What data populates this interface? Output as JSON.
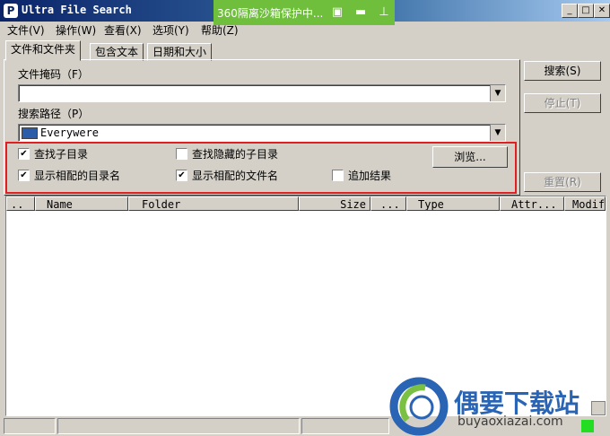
{
  "window": {
    "title": "Ultra File Search",
    "minimize_glyph": "_",
    "maximize_glyph": "□",
    "close_glyph": "✕"
  },
  "sandbox_overlay": {
    "text": "360隔离沙箱保护中...",
    "icons": [
      "shield-icon",
      "folder-icon",
      "pin-icon"
    ],
    "color": "#6fbf3c"
  },
  "menu": [
    "文件(V)",
    "操作(W)",
    "查看(X)",
    "选项(Y)",
    "帮助(Z)"
  ],
  "tabs": [
    "文件和文件夹",
    "包含文本",
    "日期和大小"
  ],
  "form": {
    "file_mask_label": "文件掩码（F）",
    "file_mask_value": "",
    "search_path_label": "搜索路径（P）",
    "search_path_value": "Everywere",
    "checkboxes": [
      {
        "label": "查找子目录",
        "checked": true
      },
      {
        "label": "查找隐藏的子目录",
        "checked": false
      },
      {
        "label": "显示相配的目录名",
        "checked": true
      },
      {
        "label": "显示相配的文件名",
        "checked": true
      },
      {
        "label": "追加结果",
        "checked": false
      }
    ],
    "browse_label": "浏览..."
  },
  "actions": {
    "search": "搜索(S)",
    "stop": "停止(T)",
    "reset": "重置(R)"
  },
  "columns": [
    "..",
    "Name",
    "Folder",
    "Size",
    "...",
    "Type",
    "Attr...",
    "Modif"
  ],
  "watermark": {
    "title": "偶要下载站",
    "url": "buyaoxiazai.com"
  },
  "colors": {
    "highlight": "#e02020",
    "titlebar": "#0a246a"
  }
}
